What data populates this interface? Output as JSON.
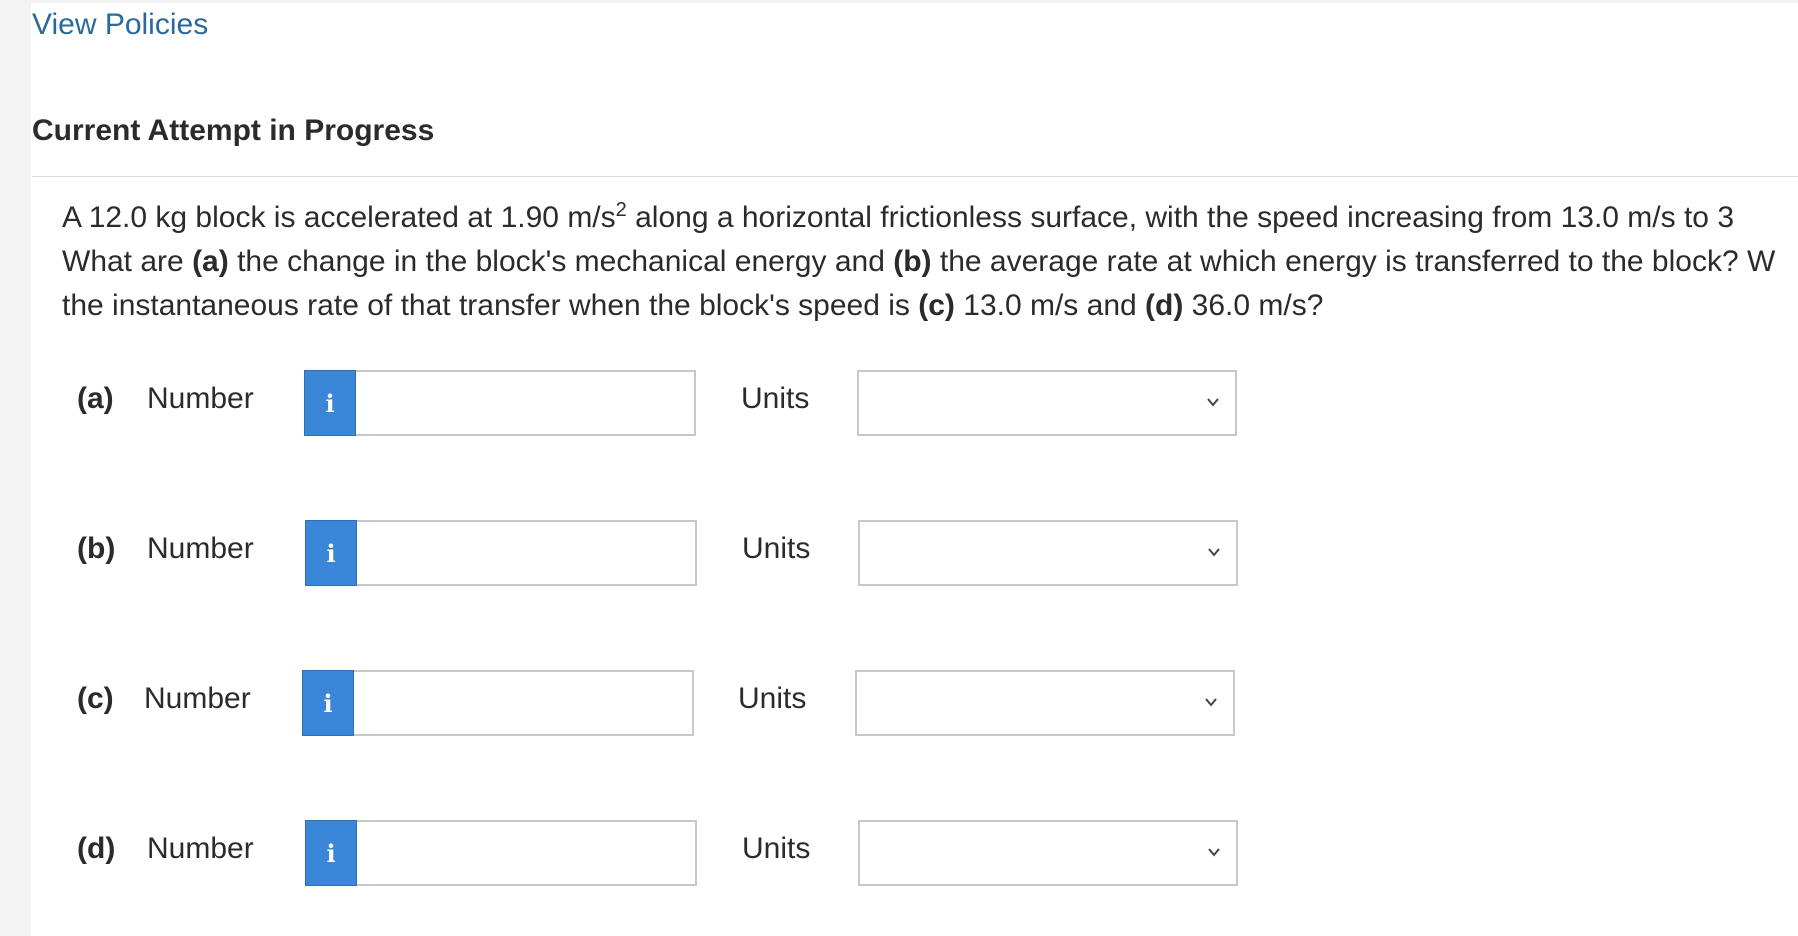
{
  "header": {
    "view_policies": "View Policies",
    "attempt_title": "Current Attempt in Progress"
  },
  "question": {
    "line1_pre": "A 12.0 kg block is accelerated at 1.90 m/s",
    "line1_sup": "2",
    "line1_post": " along a horizontal frictionless surface, with the speed increasing from 13.0 m/s to 3",
    "line2_t1": "What are ",
    "line2_b1": "(a)",
    "line2_t2": " the change in the block's mechanical energy and ",
    "line2_b2": "(b)",
    "line2_t3": " the average rate at which energy is transferred to the block? W",
    "line3_t1": "the instantaneous rate of that transfer when the block's speed is ",
    "line3_b1": "(c)",
    "line3_t2": " 13.0 m/s and ",
    "line3_b2": "(d)",
    "line3_t3": " 36.0 m/s?"
  },
  "answers": [
    {
      "part": "(a)",
      "number_label": "Number",
      "info_icon": "i",
      "value": "",
      "units_label": "Units",
      "units_value": ""
    },
    {
      "part": "(b)",
      "number_label": "Number",
      "info_icon": "i",
      "value": "",
      "units_label": "Units",
      "units_value": ""
    },
    {
      "part": "(c)",
      "number_label": "Number",
      "info_icon": "i",
      "value": "",
      "units_label": "Units",
      "units_value": ""
    },
    {
      "part": "(d)",
      "number_label": "Number",
      "info_icon": "i",
      "value": "",
      "units_label": "Units",
      "units_value": ""
    }
  ],
  "colors": {
    "link": "#2a6a9a",
    "info_button": "#3a86d8",
    "text": "#2b2b2b"
  },
  "icons": {
    "info": "info-icon",
    "dropdown": "chevron-down-icon"
  }
}
